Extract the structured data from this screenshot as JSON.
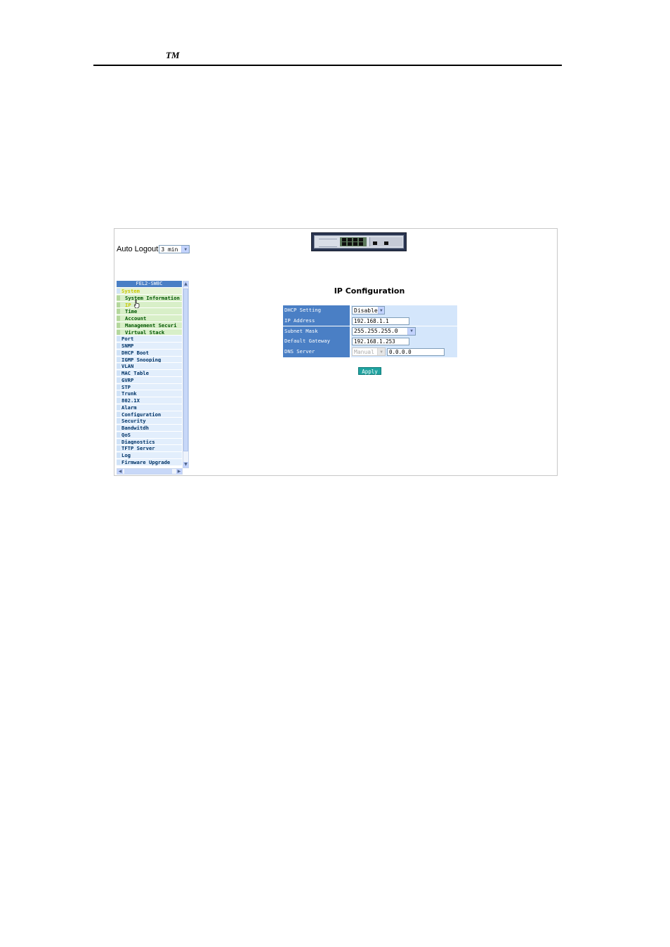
{
  "document": {
    "header_mark": "TM"
  },
  "auto_logout": {
    "label": "Auto Logout",
    "value": "3 min"
  },
  "sidebar": {
    "header": "FEL2-SW8C",
    "system": "System",
    "system_items": [
      "System Information",
      "IP",
      "Time",
      "Account",
      "Management Securi",
      "Virtual Stack"
    ],
    "items": [
      "Port",
      "SNMP",
      "DHCP Boot",
      "IGMP Snooping",
      "VLAN",
      "MAC Table",
      "GVRP",
      "STP",
      "Trunk",
      "802.1X",
      "Alarm",
      "Configuration",
      "Security",
      "Bandwitdh",
      "QoS",
      "Diagnostics",
      "TFTP Server",
      "Log",
      "Firmware Upgrade"
    ]
  },
  "page": {
    "title": "IP Configuration",
    "fields": {
      "dhcp": {
        "label": "DHCP Setting",
        "value": "Disable"
      },
      "ip": {
        "label": "IP Address",
        "value": "192.168.1.1"
      },
      "mask": {
        "label": "Subnet Mask",
        "value": "255.255.255.0"
      },
      "gateway": {
        "label": "Default Gateway",
        "value": "192.168.1.253"
      },
      "dns": {
        "label": "DNS Server",
        "mode": "Manual",
        "value": "0.0.0.0"
      }
    },
    "apply_label": "Apply"
  }
}
